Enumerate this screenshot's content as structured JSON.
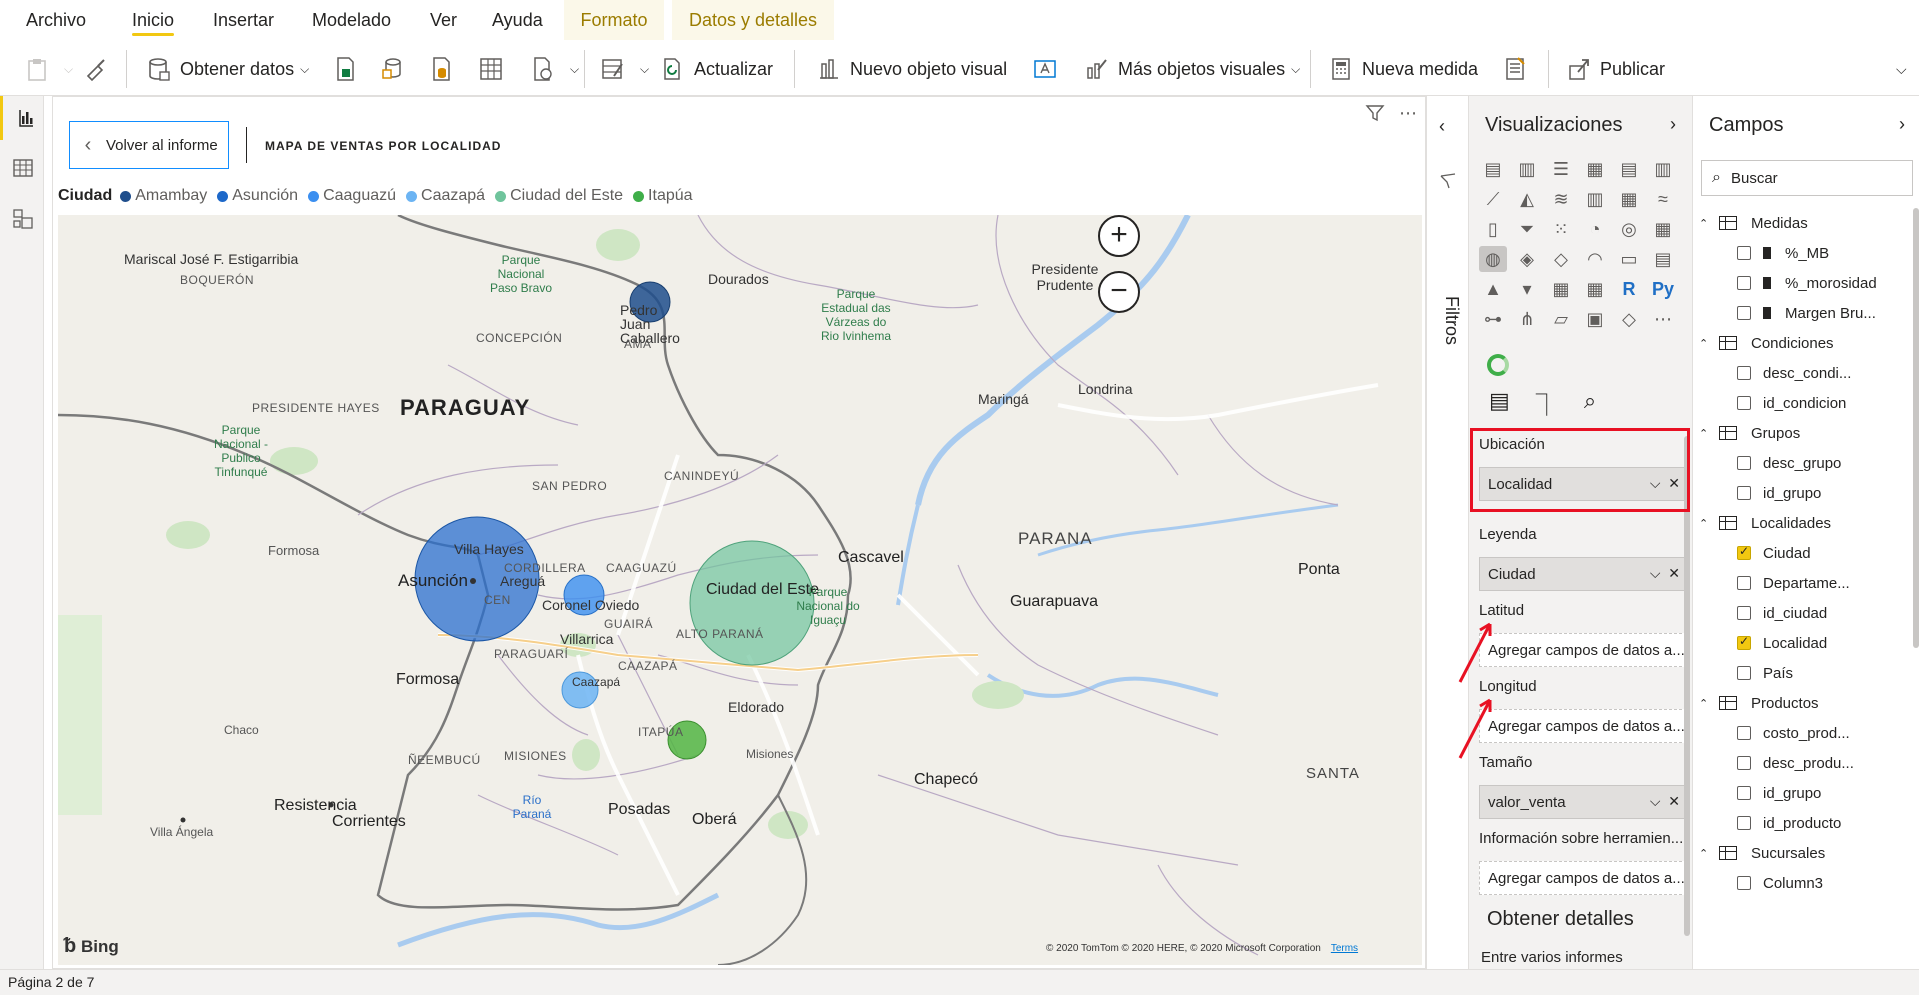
{
  "ribbon": {
    "tabs": [
      {
        "label": "Archivo"
      },
      {
        "label": "Inicio"
      },
      {
        "label": "Insertar"
      },
      {
        "label": "Modelado"
      },
      {
        "label": "Ver"
      },
      {
        "label": "Ayuda"
      },
      {
        "label": "Formato"
      },
      {
        "label": "Datos y detalles"
      }
    ],
    "active_tab": "Inicio"
  },
  "toolbar": {
    "obtener_datos": "Obtener datos",
    "actualizar": "Actualizar",
    "nuevo_objeto_visual": "Nuevo objeto visual",
    "mas_objetos_visuales": "Más objetos visuales",
    "nueva_medida": "Nueva medida",
    "publicar": "Publicar"
  },
  "canvas": {
    "back_button": "Volver al informe",
    "visual_title": "MAPA DE VENTAS POR LOCALIDAD",
    "legend": {
      "title": "Ciudad",
      "items": [
        {
          "name": "Amambay",
          "color": "#12239e"
        },
        {
          "name": "Asunción",
          "color": "#1d68c9"
        },
        {
          "name": "Caaguazú",
          "color": "#3b8ff0"
        },
        {
          "name": "Caazapá",
          "color": "#6cb4f3"
        },
        {
          "name": "Ciudad del Este",
          "color": "#6fc49c"
        },
        {
          "name": "Itapúa",
          "color": "#3fae49"
        }
      ]
    }
  },
  "map": {
    "labels": {
      "estigarribia": "Mariscal José F. Estigarribia",
      "boqueron": "BOQUERÓN",
      "parque_paso_bravo": "Parque Nacional Paso Bravo",
      "concepcion": "CONCEPCIÓN",
      "dourados": "Dourados",
      "pedro_juan": "Pedro Juan Caballero",
      "ama": "AMA",
      "parque_varzeas": "Parque Estadual das Várzeas do Rio Ivinhema",
      "presidente_prudente": "Presidente Prudente",
      "presidente_hayes": "PRESIDENTE HAYES",
      "paraguay": "PARAGUAY",
      "maringa": "Maringá",
      "londrina": "Londrina",
      "parque_tinfunque": "Parque Nacional - Publico Tinfunqué",
      "canindeyu": "CANINDEYÚ",
      "san_pedro": "SAN PEDRO",
      "parana": "PARANA",
      "formosa_prov": "Formosa",
      "villa_hayes": "Villa Hayes",
      "cordillera": "CORDILLERA",
      "caaguazu": "CAAGUAZÚ",
      "cascavel": "Cascavel",
      "ponta": "Ponta",
      "asuncion": "Asunción",
      "aregua": "Areguá",
      "cen": "CEN",
      "coronel_oviedo": "Coronel Oviedo",
      "ciudad_del_este": "Ciudad del Este",
      "parque_iguacu": "Parque Nacional do Iguaçu",
      "guarapuava": "Guarapuava",
      "guaira": "GUAIRÁ",
      "alto_parana": "ALTO PARANÁ",
      "villarrica": "Villarrica",
      "paraguari": "PARAGUARÍ",
      "formosa_city": "Formosa",
      "caazapa_dep": "CAAZAPÁ",
      "caazapa_city": "Caazapá",
      "eldorado": "Eldorado",
      "chaco": "Chaco",
      "itapua": "ITAPÚA",
      "neembucu": "ÑEEMBUCÚ",
      "misiones_py": "MISIONES",
      "misiones_ar": "Misiones",
      "chapeco": "Chapecó",
      "santa": "SANTA",
      "resistencia": "Resistencia",
      "rio_parana": "Río Paraná",
      "posadas": "Posadas",
      "obera": "Oberá",
      "corrientes": "Corrientes",
      "villa_angela": "Villa Ángela"
    },
    "bing": "Bing",
    "copyright": "© 2020 TomTom © 2020 HERE, © 2020 Microsoft Corporation",
    "terms": "Terms"
  },
  "filters": {
    "label": "Filtros"
  },
  "visualizations": {
    "title": "Visualizaciones",
    "wells": {
      "ubicacion_label": "Ubicación",
      "ubicacion_value": "Localidad",
      "leyenda_label": "Leyenda",
      "leyenda_value": "Ciudad",
      "latitud_label": "Latitud",
      "latitud_placeholder": "Agregar campos de datos a...",
      "longitud_label": "Longitud",
      "longitud_placeholder": "Agregar campos de datos a...",
      "tamano_label": "Tamaño",
      "tamano_value": "valor_venta",
      "info_label": "Información sobre herramien...",
      "info_placeholder": "Agregar campos de datos a..."
    },
    "obtener_detalles": "Obtener detalles",
    "entre_informes": "Entre varios informes"
  },
  "fields": {
    "title": "Campos",
    "search_placeholder": "Buscar",
    "tables": [
      {
        "name": "Medidas",
        "fields": [
          {
            "name": "%_MB",
            "checked": false
          },
          {
            "name": "%_morosidad",
            "checked": false
          },
          {
            "name": "Margen Bru...",
            "checked": false
          }
        ]
      },
      {
        "name": "Condiciones",
        "fields": [
          {
            "name": "desc_condi...",
            "checked": false
          },
          {
            "name": "id_condicion",
            "checked": false
          }
        ]
      },
      {
        "name": "Grupos",
        "fields": [
          {
            "name": "desc_grupo",
            "checked": false
          },
          {
            "name": "id_grupo",
            "checked": false
          }
        ]
      },
      {
        "name": "Localidades",
        "fields": [
          {
            "name": "Ciudad",
            "checked": true
          },
          {
            "name": "Departame...",
            "checked": false
          },
          {
            "name": "id_ciudad",
            "checked": false
          },
          {
            "name": "Localidad",
            "checked": true
          },
          {
            "name": "País",
            "checked": false
          }
        ]
      },
      {
        "name": "Productos",
        "fields": [
          {
            "name": "costo_prod...",
            "checked": false
          },
          {
            "name": "desc_produ...",
            "checked": false
          },
          {
            "name": "id_grupo",
            "checked": false
          },
          {
            "name": "id_producto",
            "checked": false
          }
        ]
      },
      {
        "name": "Sucursales",
        "fields": [
          {
            "name": "Column3",
            "checked": false
          }
        ]
      }
    ]
  },
  "status": {
    "page": "Página 2 de 7"
  }
}
